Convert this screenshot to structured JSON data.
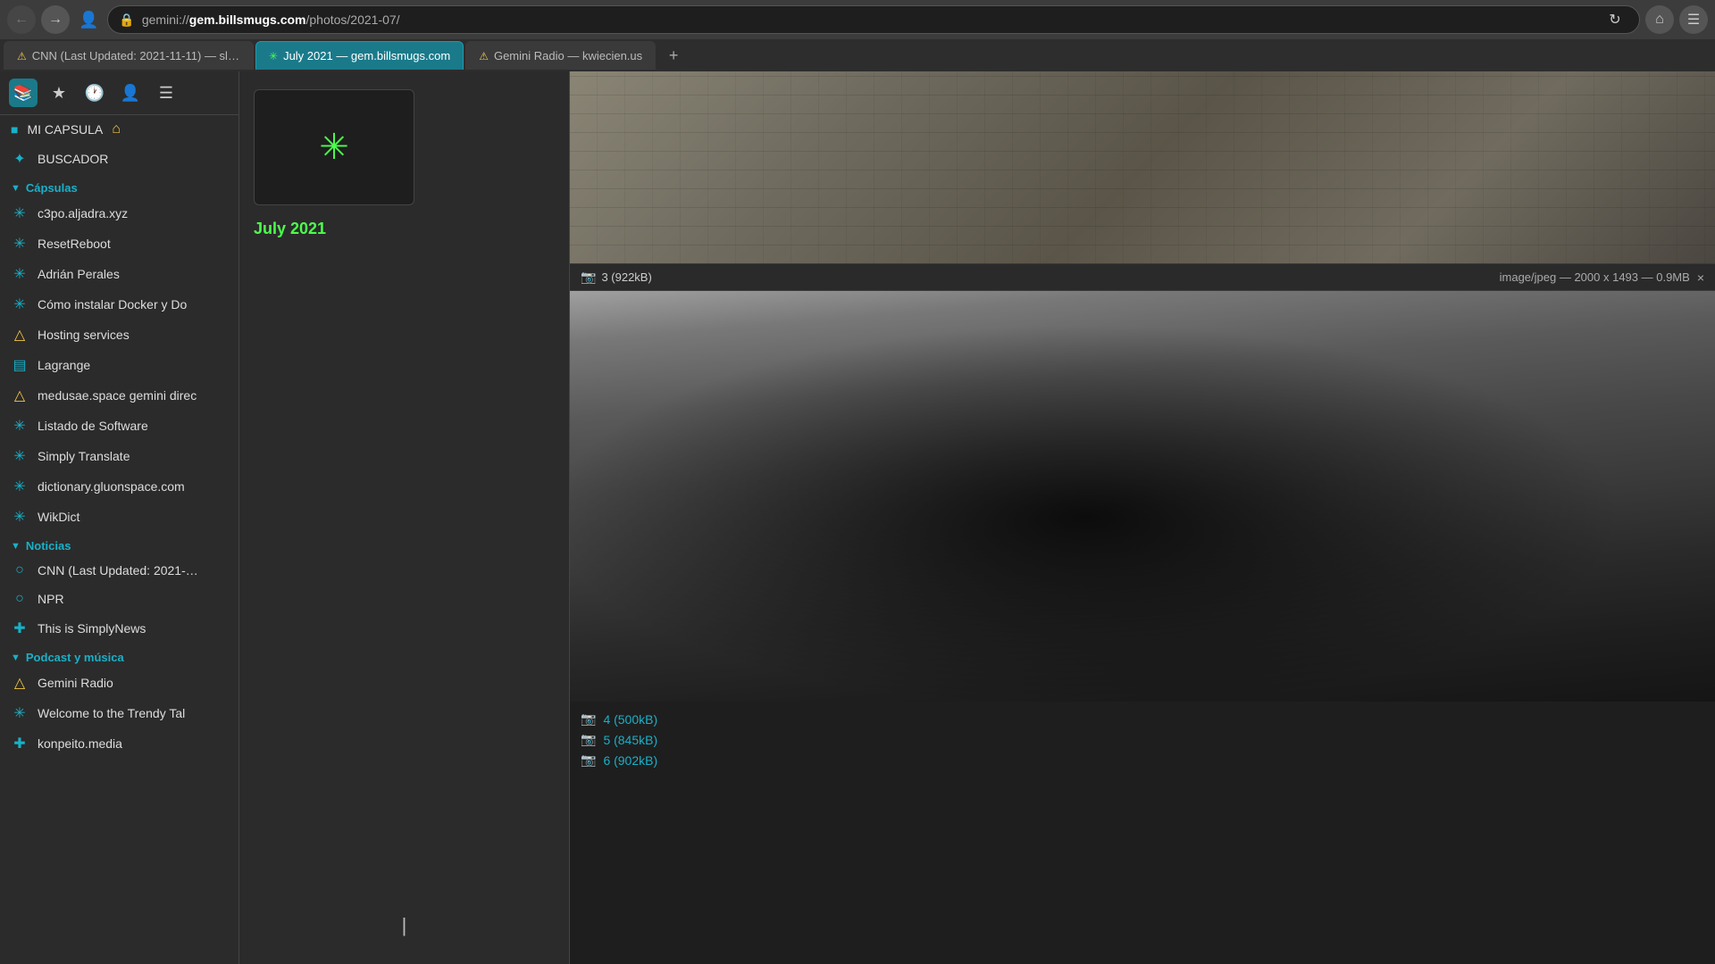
{
  "browser": {
    "back_btn": "←",
    "forward_btn": "→",
    "url": {
      "protocol": "gemini://",
      "host": "gem.billsmugs.com",
      "path": "/photos/2021-07/",
      "full": "gemini://gem.billsmugs.com/photos/2021-07/"
    },
    "refresh_btn": "↻",
    "home_btn": "⌂",
    "menu_btn": "≡",
    "user_icon": "👤",
    "lock_icon": "🔒"
  },
  "tabs": [
    {
      "id": "tab1",
      "label": "CNN (Last Updated: 2021-11-11) — sloum",
      "icon": "⚠",
      "active": false
    },
    {
      "id": "tab2",
      "label": "July 2021 — gem.billsmugs.com",
      "icon": "✳",
      "active": true
    },
    {
      "id": "tab3",
      "label": "Gemini Radio — kwiecien.us",
      "icon": "⚠",
      "active": false
    }
  ],
  "sidebar": {
    "tools": [
      {
        "id": "book",
        "icon": "📖",
        "active": true
      },
      {
        "id": "star",
        "icon": "★",
        "active": false
      },
      {
        "id": "history",
        "icon": "🕐",
        "active": false
      },
      {
        "id": "user",
        "icon": "👤",
        "active": false
      },
      {
        "id": "list",
        "icon": "☰",
        "active": false
      }
    ],
    "mi_capsula": "MI CAPSULA",
    "buscador": "BUSCADOR",
    "categories": [
      {
        "name": "Cápsulas",
        "expanded": true,
        "items": [
          {
            "label": "c3po.aljadra.xyz",
            "icon": "✳"
          },
          {
            "label": "ResetReboot",
            "icon": "✳"
          },
          {
            "label": "Adrián Perales",
            "icon": "✳"
          },
          {
            "label": "Cómo instalar Docker y Do",
            "icon": "✳"
          },
          {
            "label": "Hosting services",
            "icon": "⚠"
          },
          {
            "label": "Lagrange",
            "icon": "☰"
          },
          {
            "label": "medusae.space gemini direc",
            "icon": "⚠"
          },
          {
            "label": "Listado de Software",
            "icon": "✳"
          },
          {
            "label": "Simply Translate",
            "icon": "✳"
          },
          {
            "label": "dictionary.gluonspace.com",
            "icon": "✳"
          },
          {
            "label": "WikDict",
            "icon": "✳"
          }
        ]
      },
      {
        "name": "Noticias",
        "expanded": true,
        "items": [
          {
            "label": "CNN (Last Updated: 2021-…",
            "icon": "◎"
          },
          {
            "label": "NPR",
            "icon": "◎"
          },
          {
            "label": "This is SimplyNews",
            "icon": "✦"
          }
        ]
      },
      {
        "name": "Podcast y música",
        "expanded": true,
        "items": [
          {
            "label": "Gemini Radio",
            "icon": "⚠"
          },
          {
            "label": "Welcome to the Trendy Tal",
            "icon": "✳"
          },
          {
            "label": "konpeito.media",
            "icon": "✦"
          }
        ]
      }
    ]
  },
  "left_panel": {
    "thumb_star": "✳",
    "thumb_title": "July 2021"
  },
  "content": {
    "image3": {
      "label": "3 (922kB)",
      "meta": "image/jpeg — 2000 x 1493 — 0.9MB",
      "close": "×"
    },
    "image4": {
      "label": "4 (500kB)"
    },
    "image5": {
      "label": "5 (845kB)"
    },
    "image6": {
      "label": "6 (902kB)"
    }
  }
}
